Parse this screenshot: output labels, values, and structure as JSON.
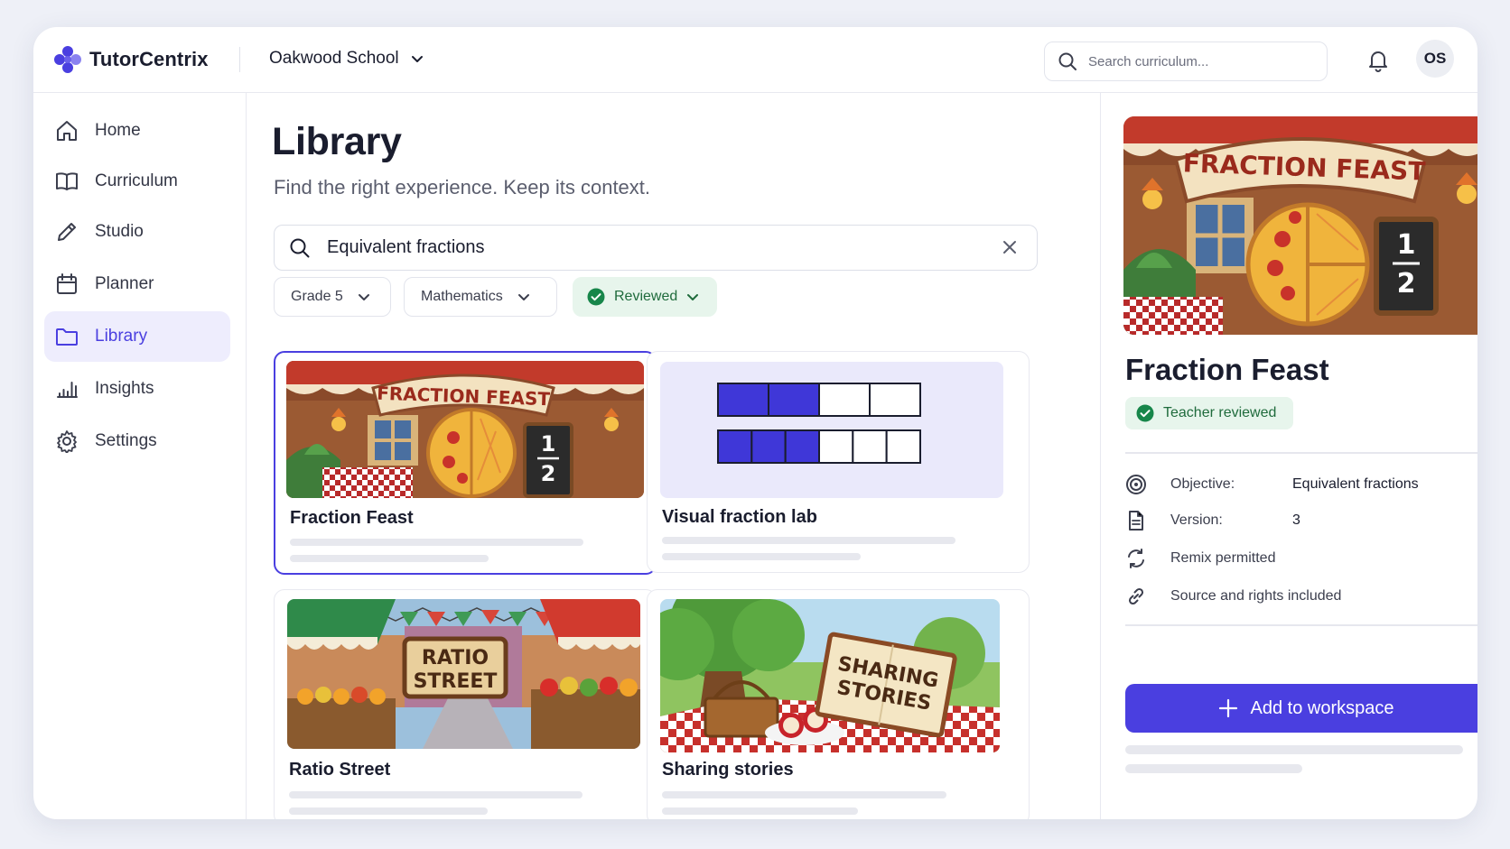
{
  "app": {
    "name": "TutorCentrix",
    "brand_color": "#4a3fe0"
  },
  "header": {
    "school": "Oakwood School",
    "search_placeholder": "Search curriculum...",
    "avatar_initials": "OS"
  },
  "sidebar": {
    "items": [
      {
        "label": "Home",
        "icon": "home-icon"
      },
      {
        "label": "Curriculum",
        "icon": "book-icon"
      },
      {
        "label": "Studio",
        "icon": "pencil-icon"
      },
      {
        "label": "Planner",
        "icon": "calendar-icon"
      },
      {
        "label": "Library",
        "icon": "folder-icon",
        "active": true
      },
      {
        "label": "Insights",
        "icon": "bar-chart-icon"
      },
      {
        "label": "Settings",
        "icon": "gear-icon"
      }
    ]
  },
  "library": {
    "title": "Library",
    "subtitle": "Find the right experience. Keep its context.",
    "search_value": "Equivalent fractions",
    "filters": [
      {
        "label": "Grade 5"
      },
      {
        "label": "Mathematics"
      },
      {
        "label": "Reviewed",
        "active": true
      }
    ],
    "cards": [
      {
        "title": "Fraction Feast",
        "selected": true,
        "thumb_sign": "FRACTION FEAST"
      },
      {
        "title": "Visual fraction lab",
        "row1_filled": 2,
        "row1_total": 4,
        "row2_filled": 3,
        "row2_total": 6
      },
      {
        "title": "Ratio Street",
        "thumb_sign_1": "RATIO",
        "thumb_sign_2": "STREET"
      },
      {
        "title": "Sharing stories",
        "thumb_sign_1": "SHARING",
        "thumb_sign_2": "STORIES"
      }
    ]
  },
  "detail": {
    "title": "Fraction Feast",
    "hero_sign": "FRACTION FEAST",
    "fraction_num": "1",
    "fraction_den": "2",
    "badge": "Teacher reviewed",
    "objective_label": "Objective:",
    "objective_value": "Equivalent fractions",
    "version_label": "Version:",
    "version_value": "3",
    "remix": "Remix permitted",
    "source": "Source and rights included",
    "add_button": "Add to workspace"
  }
}
